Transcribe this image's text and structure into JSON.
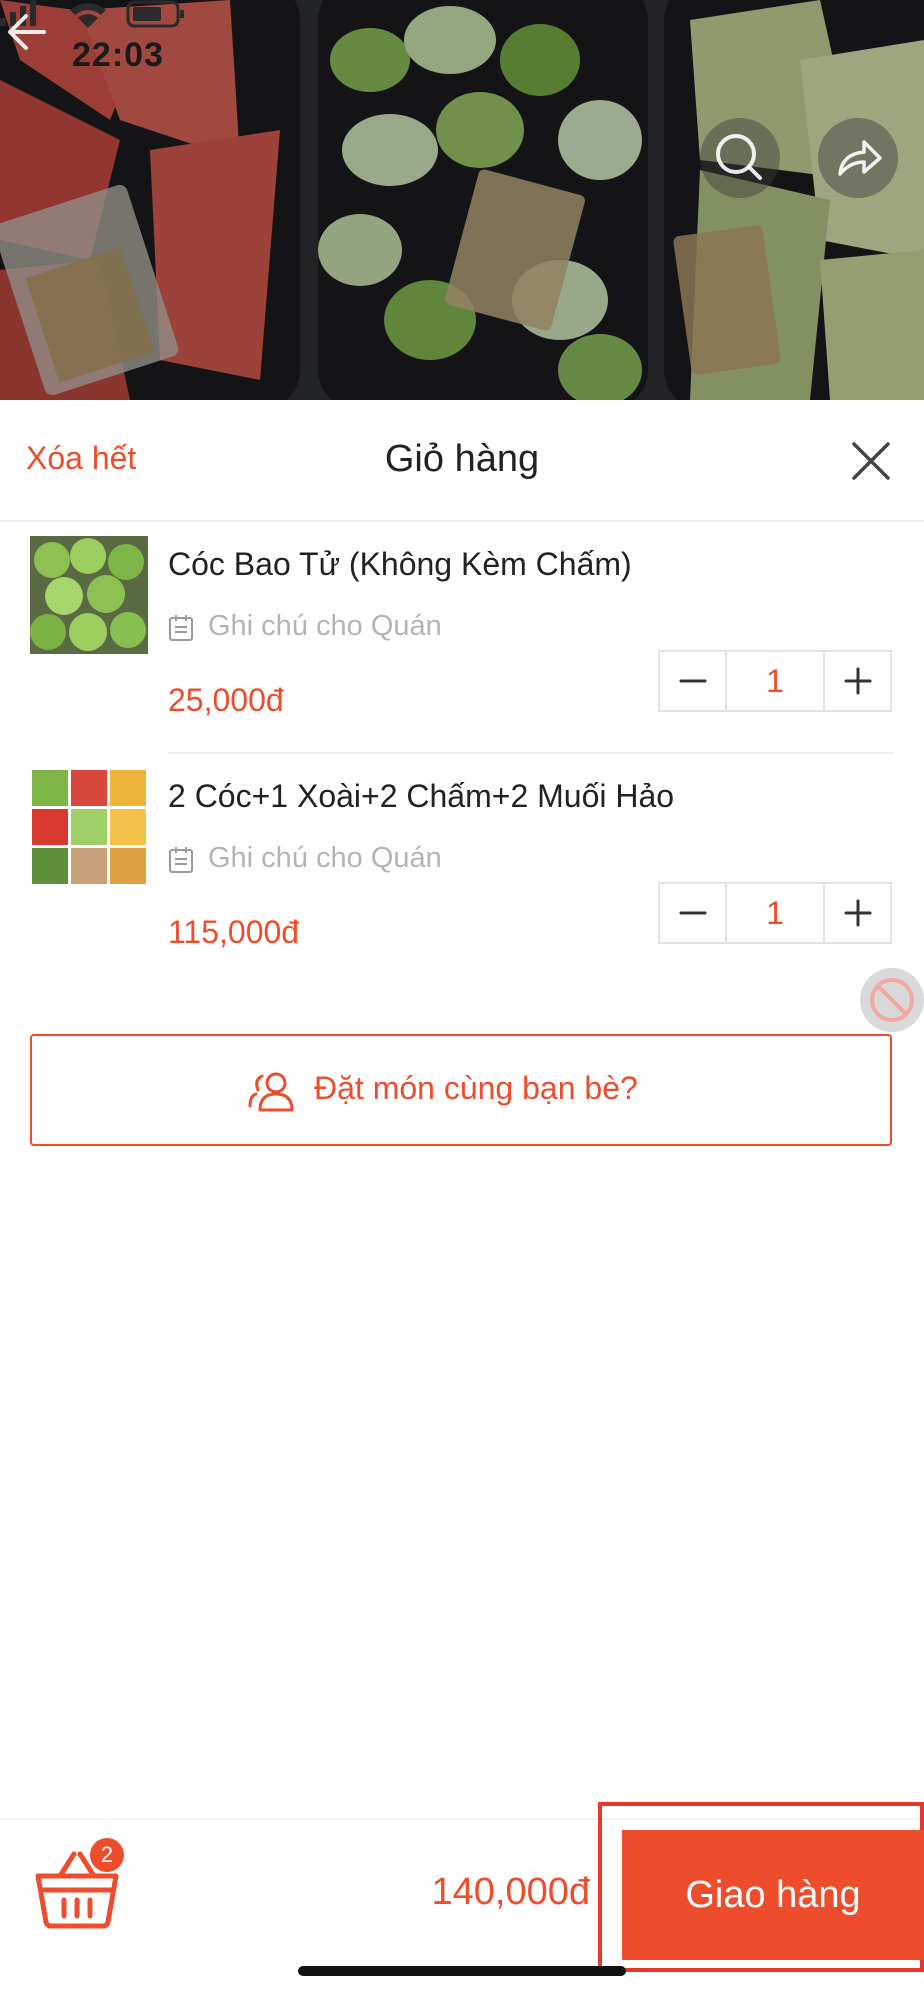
{
  "status_bar": {
    "time": "22:03"
  },
  "header_nav": {
    "back_icon": "arrow-left-icon",
    "search_icon": "search-icon",
    "share_icon": "share-icon"
  },
  "cart": {
    "clear_all_label": "Xóa hết",
    "title": "Giỏ hàng",
    "close_icon": "close-icon",
    "items": [
      {
        "name": "Cóc Bao Tử (Không Kèm Chấm)",
        "note_placeholder": "Ghi chú cho Quán",
        "price": "25,000đ",
        "quantity": "1"
      },
      {
        "name": "2 Cóc+1 Xoài+2 Chấm+2 Muối Hảo",
        "note_placeholder": "Ghi chú cho Quán",
        "price": "115,000đ",
        "quantity": "1"
      }
    ]
  },
  "group_order": {
    "label": "Đặt món cùng bạn bè?"
  },
  "bottom_bar": {
    "basket_count": "2",
    "total": "140,000đ",
    "checkout_label": "Giao hàng"
  },
  "colors": {
    "accent": "#ee4d2d",
    "muted_text": "#b4b4b4",
    "title_text": "#222222"
  }
}
